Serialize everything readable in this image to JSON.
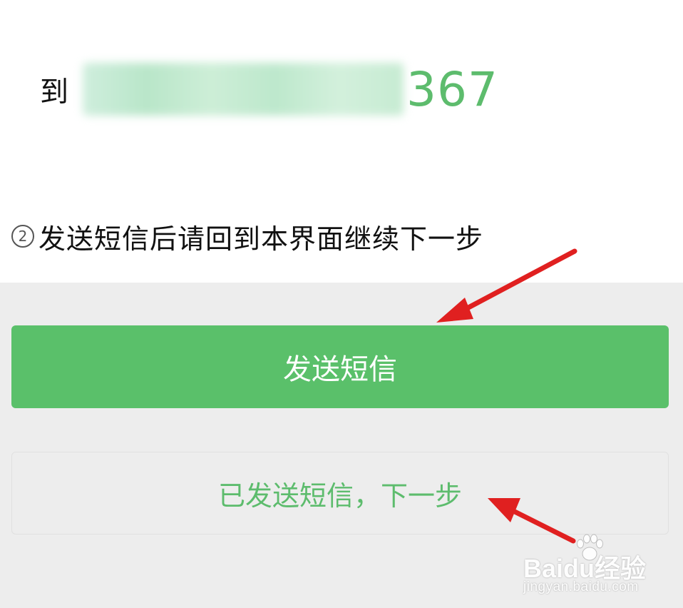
{
  "sms": {
    "to_label": "到",
    "number_visible": "367"
  },
  "instructions": {
    "step_number": "②",
    "step_text": "发送短信后请回到本界面继续下一步"
  },
  "actions": {
    "send_label": "发送短信",
    "next_label": "已发送短信，下一步"
  },
  "watermark": {
    "brand": "Baidu经验",
    "url": "jingyan.baidu.com"
  },
  "colors": {
    "accent_green": "#5ac06a",
    "number_green": "#5dbc6d",
    "annotation_red": "#e02020",
    "panel_gray": "#ededed"
  },
  "annotations": {
    "arrow_icon": "red-arrow-icon"
  }
}
